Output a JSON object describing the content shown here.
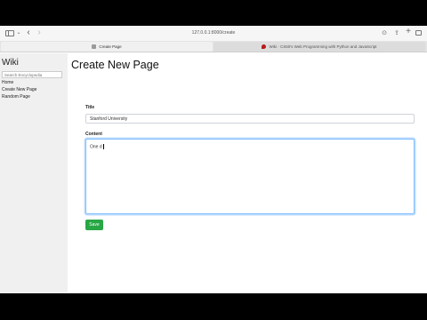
{
  "browser": {
    "url": "127.0.0.1:8000/create",
    "tabs": [
      {
        "label": "Create Page",
        "active": true
      },
      {
        "label": "Wiki - CS50's Web Programming with Python and JavaScript",
        "active": false
      }
    ],
    "icons": {
      "sidebar": "sidebar-icon",
      "back": "chevron-left-icon",
      "forward": "chevron-right-icon",
      "download": "download-icon",
      "share": "share-icon",
      "new_tab": "plus-icon",
      "tabs": "tabs-overview-icon"
    }
  },
  "sidebar": {
    "title": "Wiki",
    "search_placeholder": "Search Encyclopedia",
    "links": [
      {
        "label": "Home"
      },
      {
        "label": "Create New Page"
      },
      {
        "label": "Random Page"
      }
    ]
  },
  "main": {
    "heading": "Create New Page",
    "title_label": "Title",
    "title_value": "Stanford University",
    "content_label": "Content",
    "content_value": "One d",
    "save_label": "Save"
  },
  "colors": {
    "save_button": "#28a745",
    "focus_border": "#80bdff",
    "sidebar_bg": "#f0f0f0"
  }
}
